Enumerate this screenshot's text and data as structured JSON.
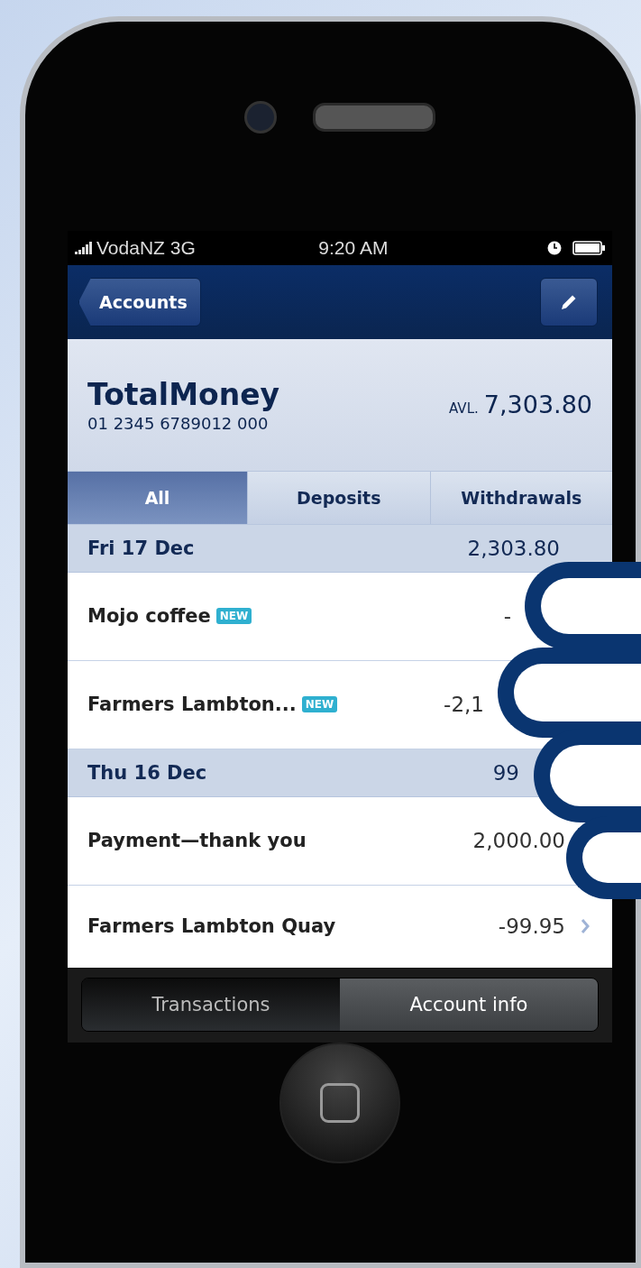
{
  "status_bar": {
    "carrier": "VodaNZ 3G",
    "time": "9:20 AM"
  },
  "nav_bar": {
    "back_button": "Accounts"
  },
  "account": {
    "name": "TotalMoney",
    "number": "01 2345 6789012 000",
    "balance_label": "AVL.",
    "balance": "7,303.80"
  },
  "filter_tabs": [
    {
      "label": "All",
      "selected": true
    },
    {
      "label": "Deposits",
      "selected": false
    },
    {
      "label": "Withdrawals",
      "selected": false
    }
  ],
  "transactions": [
    {
      "kind": "date",
      "label": "Fri 17 Dec",
      "amount": "2,303.80"
    },
    {
      "kind": "item",
      "label": "Mojo coffee",
      "badge": "NEW",
      "amount": "-",
      "chevron": false
    },
    {
      "kind": "item",
      "label": "Farmers Lambton...",
      "badge": "NEW",
      "amount": "-2,1",
      "chevron": false
    },
    {
      "kind": "date",
      "label": "Thu 16 Dec",
      "amount": "99"
    },
    {
      "kind": "item",
      "label": "Payment—thank you",
      "amount": "2,000.00",
      "chevron": false
    },
    {
      "kind": "item",
      "label": "Farmers Lambton Quay",
      "amount": "-99.95",
      "chevron": true
    }
  ],
  "bottom_segments": [
    {
      "label": "Transactions",
      "selected": true
    },
    {
      "label": "Account info",
      "selected": false
    }
  ]
}
